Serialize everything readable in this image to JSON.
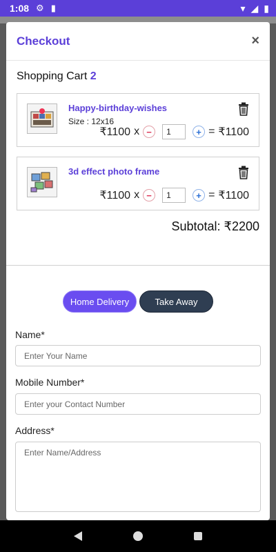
{
  "status_bar": {
    "time": "1:08",
    "icons": [
      "gear-icon",
      "sd-card-icon",
      "wifi-icon",
      "signal-icon",
      "battery-icon"
    ]
  },
  "modal": {
    "title": "Checkout",
    "close_glyph": "×"
  },
  "cart": {
    "title": "Shopping Cart",
    "count": "2",
    "items": [
      {
        "name": "Happy-birthday-wishes",
        "size": "Size : 12x16",
        "price": "₹1100",
        "qty": "1",
        "total": "₹1100"
      },
      {
        "name": "3d effect photo frame",
        "size": "",
        "price": "₹1100",
        "qty": "1",
        "total": "₹1100"
      }
    ],
    "subtotal": "Subtotal: ₹2200"
  },
  "delivery": {
    "home_label": "Home Delivery",
    "takeaway_label": "Take Away",
    "selected": "Home Delivery"
  },
  "form": {
    "name_label": "Name*",
    "name_placeholder": "Enter Your Name",
    "mobile_label": "Mobile Number*",
    "mobile_placeholder": "Enter your Contact Number",
    "address_label": "Address*",
    "address_placeholder": "Enter Name/Address"
  },
  "colors": {
    "accent": "#5b3fd8",
    "takeaway": "#2f3e52",
    "minus": "#dd3355",
    "plus": "#2a6fd6"
  }
}
